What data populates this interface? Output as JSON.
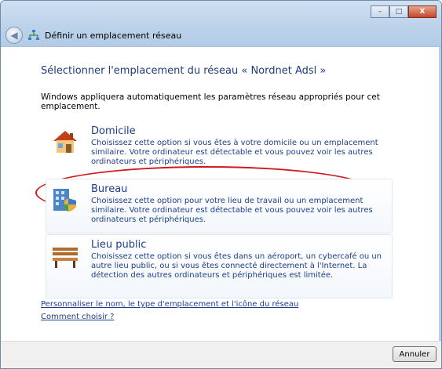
{
  "window": {
    "title": "Définir un emplacement réseau",
    "controls": {
      "minimize": "–",
      "maximize": "□",
      "close": "X"
    }
  },
  "main": {
    "heading": "Sélectionner l'emplacement du réseau « Nordnet Adsl »",
    "intro": "Windows appliquera automatiquement les paramètres réseau appropriés pour cet emplacement.",
    "options": [
      {
        "title": "Domicile",
        "description": "Choisissez cette option si vous êtes à votre domicile ou un emplacement similaire. Votre ordinateur est détectable et vous pouvez voir les autres ordinateurs et périphériques.",
        "icon": "home-icon"
      },
      {
        "title": "Bureau",
        "description": "Choisissez cette option pour votre lieu de travail ou un emplacement similaire. Votre ordinateur est détectable et vous pouvez voir les autres ordinateurs et périphériques.",
        "icon": "office-building-icon"
      },
      {
        "title": "Lieu public",
        "description": "Choisissez cette option si vous êtes dans un aéroport, un cybercafé ou un autre lieu public, ou si vous êtes connecté directement à l'Internet. La détection des autres ordinateurs et périphériques est limitée.",
        "icon": "park-bench-icon"
      }
    ],
    "links": [
      "Personnaliser le nom, le type d'emplacement et l'icône du réseau",
      "Comment choisir ?"
    ]
  },
  "footer": {
    "cancel_label": "Annuler"
  },
  "colors": {
    "highlight_ellipse": "#d0181c",
    "link": "#1c3e8c",
    "heading": "#1f3b7a"
  }
}
